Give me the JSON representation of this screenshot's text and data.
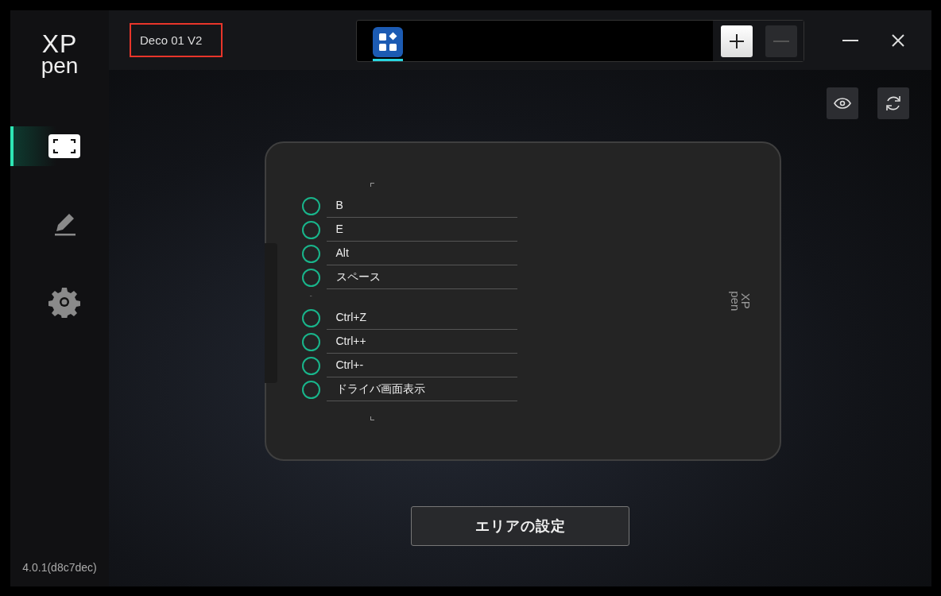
{
  "sidebar": {
    "logo": [
      "XP",
      "pen"
    ],
    "items": [
      {
        "kind": "area",
        "selected": true
      },
      {
        "kind": "pen",
        "selected": false
      },
      {
        "kind": "settings",
        "selected": false
      }
    ],
    "version": "4.0.1(d8c7dec)"
  },
  "header": {
    "device": "Deco 01 V2",
    "apps": [
      {
        "selected": true
      }
    ],
    "add_disabled": false,
    "remove_disabled": true
  },
  "tablet": {
    "keys": [
      {
        "kind": "key",
        "label": "B"
      },
      {
        "kind": "key",
        "label": "E"
      },
      {
        "kind": "key",
        "label": "Alt"
      },
      {
        "kind": "key",
        "label": "スペース"
      },
      {
        "kind": "separator",
        "label": "-"
      },
      {
        "kind": "key",
        "label": "Ctrl+Z"
      },
      {
        "kind": "key",
        "label": "Ctrl++"
      },
      {
        "kind": "key",
        "label": "Ctrl+-"
      },
      {
        "kind": "key",
        "label": "ドライバ画面表示"
      }
    ],
    "logo": [
      "XP",
      "pen"
    ]
  },
  "area_button": "エリアの設定"
}
